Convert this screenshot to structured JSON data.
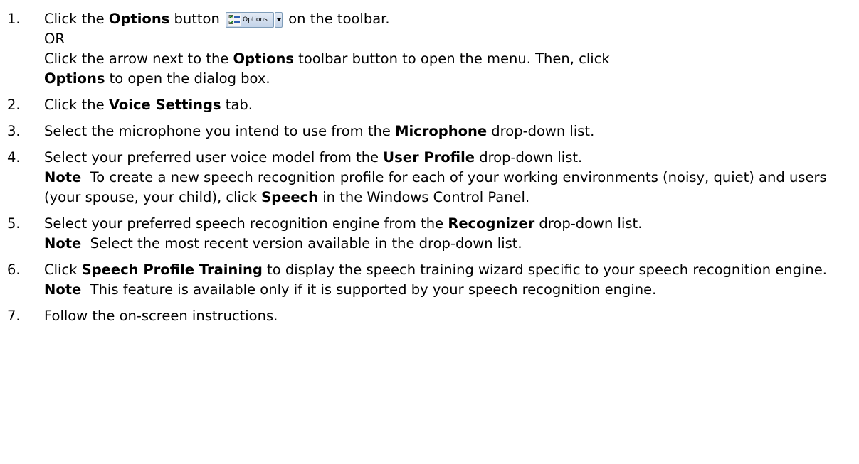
{
  "steps": [
    {
      "number": "1.",
      "lines": [
        {
          "pre": "Click the ",
          "bold": "Options",
          "post": " button ",
          "after_button": " on the toolbar."
        },
        {
          "text": "OR"
        },
        {
          "text": "Click the arrow next to the ",
          "bold": "Options",
          "post": " toolbar button to open the menu. Then, click"
        },
        {
          "bold": "Options",
          "post": " to open the dialog box."
        }
      ]
    },
    {
      "number": "2.",
      "pre": "Click the ",
      "bold": "Voice Settings",
      "post": " tab."
    },
    {
      "number": "3.",
      "pre": "Select the microphone you intend to use from the ",
      "bold": "Microphone",
      "post": " drop-down list."
    },
    {
      "number": "4.",
      "pre": "Select your preferred user voice model from the ",
      "bold": "User Profile",
      "post": " drop-down list.",
      "note_label": "Note",
      "note_pre": "  To create a new speech recognition profile for each of your working environments (noisy, quiet) and users (your spouse, your child), click ",
      "note_bold": "Speech",
      "note_post": " in the Windows Control Panel."
    },
    {
      "number": "5.",
      "pre": "Select your preferred speech recognition engine from the ",
      "bold": "Recognizer",
      "post": " drop-down list.",
      "note_label": "Note",
      "note_text": "  Select the most recent version available in the drop-down list."
    },
    {
      "number": "6.",
      "pre": "Click ",
      "bold": "Speech Profile Training",
      "post": " to display the speech training wizard specific to your speech recognition engine.",
      "note_label": "Note",
      "note_text": "  This feature is available only if it is supported by your speech recognition engine."
    },
    {
      "number": "7.",
      "text": "Follow the on-screen instructions."
    }
  ],
  "toolbar_button": {
    "label": "Options",
    "icon": "checklist-options-icon",
    "dropdown_icon": "dropdown-arrow-icon"
  }
}
